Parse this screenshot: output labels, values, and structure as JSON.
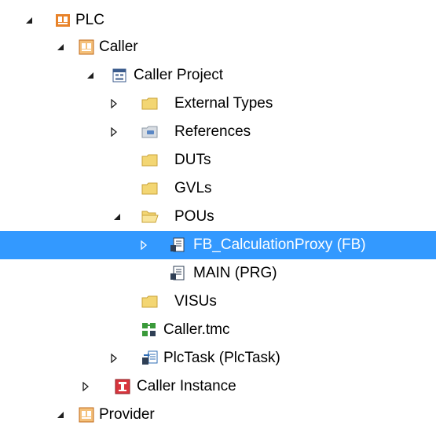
{
  "tree": {
    "nodes": [
      {
        "label": "PLC",
        "icon": "plc-icon",
        "expander": "expanded"
      },
      {
        "label": "Caller",
        "icon": "plc-project-icon",
        "expander": "expanded"
      },
      {
        "label": "Caller Project",
        "icon": "project-icon",
        "expander": "expanded"
      },
      {
        "label": "External Types",
        "icon": "folder-icon",
        "expander": "collapsed"
      },
      {
        "label": "References",
        "icon": "references-icon",
        "expander": "collapsed"
      },
      {
        "label": "DUTs",
        "icon": "folder-icon",
        "expander": "none"
      },
      {
        "label": "GVLs",
        "icon": "folder-icon",
        "expander": "none"
      },
      {
        "label": "POUs",
        "icon": "folder-open-icon",
        "expander": "expanded"
      },
      {
        "label": "FB_CalculationProxy (FB)",
        "icon": "pou-icon",
        "expander": "collapsed",
        "selected": true
      },
      {
        "label": "MAIN (PRG)",
        "icon": "pou-icon",
        "expander": "none"
      },
      {
        "label": "VISUs",
        "icon": "folder-icon",
        "expander": "none"
      },
      {
        "label": "Caller.tmc",
        "icon": "tmc-icon",
        "expander": "none"
      },
      {
        "label": "PlcTask (PlcTask)",
        "icon": "task-icon",
        "expander": "collapsed"
      },
      {
        "label": "Caller Instance",
        "icon": "instance-icon",
        "expander": "collapsed"
      },
      {
        "label": "Provider",
        "icon": "plc-project-icon",
        "expander": "expanded"
      }
    ]
  },
  "colors": {
    "selection": "#3399ff",
    "folder": "#f3d673",
    "plc_orange": "#e8832a",
    "instance_red": "#d9363e"
  }
}
